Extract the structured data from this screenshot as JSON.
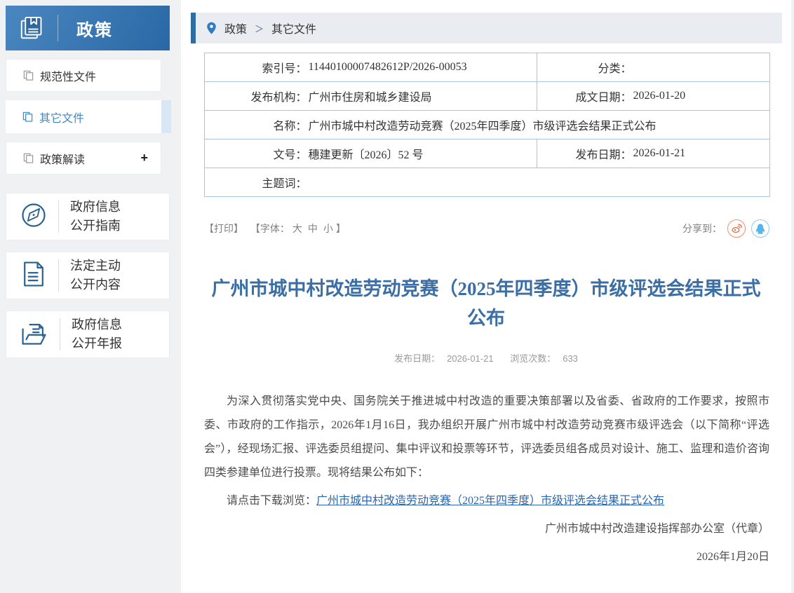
{
  "sidebar": {
    "header": {
      "title": "政策"
    },
    "items": [
      {
        "label": "规范性文件",
        "active": false
      },
      {
        "label": "其它文件",
        "active": true
      },
      {
        "label": "政策解读",
        "suffix": "+",
        "active": false
      }
    ],
    "sections": [
      {
        "line1": "政府信息",
        "line2": "公开指南",
        "icon": "compass-icon"
      },
      {
        "line1": "法定主动",
        "line2": "公开内容",
        "icon": "document-icon"
      },
      {
        "line1": "政府信息",
        "line2": "公开年报",
        "icon": "open-folder-icon"
      }
    ]
  },
  "breadcrumb": {
    "root": "政策",
    "separator": "＞",
    "current": "其它文件"
  },
  "doc_table": {
    "index_label": "索引号：",
    "index_value": "11440100007482612P/2026-00053",
    "category_label": "分类：",
    "category_value": "",
    "agency_label": "发布机构：",
    "agency_value": "广州市住房和城乡建设局",
    "written_date_label": "成文日期：",
    "written_date_value": "2026-01-20",
    "name_label": "名称：",
    "name_value": "广州市城中村改造劳动竞赛（2025年四季度）市级评选会结果正式公布",
    "doc_no_label": "文号：",
    "doc_no_value": "穗建更新〔2026〕52 号",
    "publish_date_label": "发布日期：",
    "publish_date_value": "2026-01-21",
    "keywords_label": "主题词：",
    "keywords_value": ""
  },
  "toolbar": {
    "print_label": "【打印】",
    "font_prefix": "【字体：",
    "font_large": "大",
    "font_medium": "中",
    "font_small": "小",
    "font_suffix": "】",
    "share_label": "分享到：",
    "share_icons": [
      "weibo-icon",
      "qq-icon"
    ]
  },
  "article": {
    "title": "广州市城中村改造劳动竞赛（2025年四季度）市级评选会结果正式公布",
    "publish_date_label": "发布日期：",
    "publish_date": "2026-01-21",
    "views_label": "浏览次数：",
    "views": "633",
    "paragraph1": "为深入贯彻落实党中央、国务院关于推进城中村改造的重要决策部署以及省委、省政府的工作要求，按照市委、市政府的工作指示，2026年1月16日，我办组织开展广州市城中村改造劳动竞赛市级评选会（以下简称“评选会”），经现场汇报、评选委员组提问、集中评议和投票等环节，评选委员组各成员对设计、施工、监理和造价咨询四类参建单位进行投票。现将结果公布如下：",
    "download_prompt": "请点击下载浏览：",
    "download_link_text": "广州市城中村改造劳动竞赛（2025年四季度）市级评选会结果正式公布",
    "signature": "广州市城中村改造建设指挥部办公室（代章）",
    "sign_date": "2026年1月20日"
  },
  "colors": {
    "accent_blue": "#2e6da4",
    "sidebar_gradient_start": "#4a87c0",
    "sidebar_gradient_end": "#2a68a5",
    "active_item_text": "#4189c4",
    "title_blue": "#3a6ea5",
    "link_blue": "#2965b1",
    "table_border": "#a9c4e0",
    "weibo_orange": "#e6683f",
    "qq_blue": "#56b6e7"
  }
}
